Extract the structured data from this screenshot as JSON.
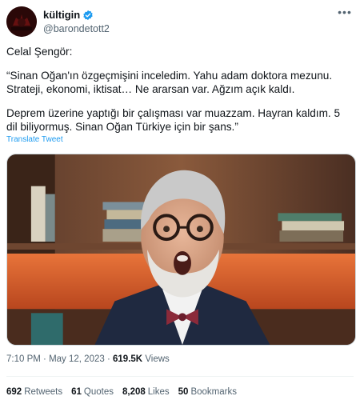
{
  "user": {
    "display_name": "kültigin",
    "handle": "@barondetott2",
    "verified_color": "#1d9bf0"
  },
  "tweet": {
    "line1": "Celal Şengör:",
    "para1": "“Sinan Oğan'ın özgeçmişini inceledim. Yahu adam doktora mezunu. Strateji, ekonomi, iktisat… Ne ararsan var. Ağzım açık kaldı.",
    "para2": "Deprem üzerine yaptığı bir çalışması var muazzam. Hayran kaldım. 5 dil biliyormuş. Sinan Oğan Türkiye için bir şans.”",
    "translate_label": "Translate Tweet"
  },
  "meta": {
    "time": "7:10 PM",
    "date": "May 12, 2023",
    "views_count": "619.5K",
    "views_label": "Views",
    "separator": "·"
  },
  "stats": {
    "retweets_count": "692",
    "retweets_label": "Retweets",
    "quotes_count": "61",
    "quotes_label": "Quotes",
    "likes_count": "8,208",
    "likes_label": "Likes",
    "bookmarks_count": "50",
    "bookmarks_label": "Bookmarks"
  },
  "icons": {
    "more": "more-options-icon",
    "verified": "verified-badge-icon"
  }
}
